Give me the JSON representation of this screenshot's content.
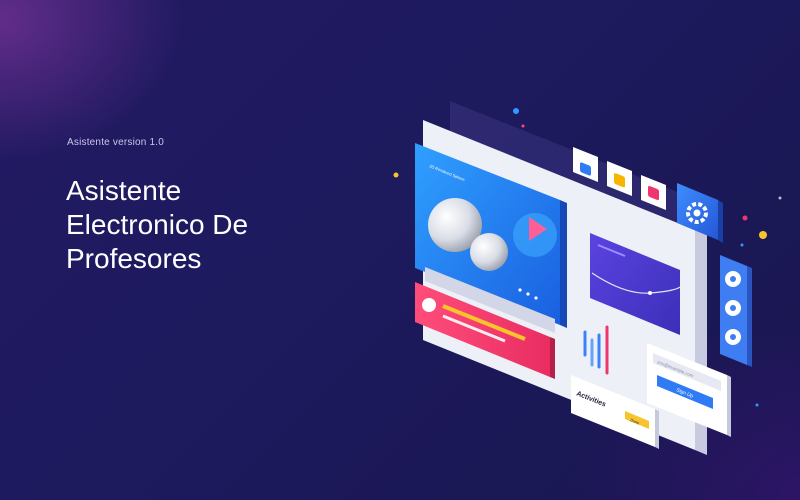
{
  "hero": {
    "version": "Asistente version 1.0",
    "title_lines": [
      "Asistente",
      "Electronico De",
      "Profesores"
    ]
  },
  "illustration": {
    "card_caption": "3D Rendered Sphere",
    "email_placeholder": "you@example.com",
    "signup_label": "Sign Up",
    "activities_label": "Activities",
    "badge_label": "Done"
  },
  "colors": {
    "background": "#1d1a5e",
    "accent_blue": "#2a7cf0",
    "accent_pink": "#f0366e",
    "accent_yellow": "#f7c52b"
  },
  "icons": [
    "bar-chart-icon",
    "home-icon",
    "cloud-icon",
    "gear-icon",
    "wifi-icon",
    "heart-icon",
    "location-icon",
    "play-icon",
    "message-icon"
  ]
}
